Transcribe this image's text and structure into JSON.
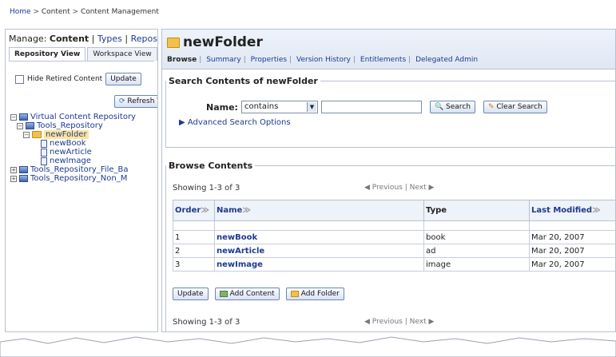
{
  "breadcrumb": [
    "Home",
    "Content",
    "Content Management"
  ],
  "left": {
    "manage_prefix": "Manage:",
    "manage_items": [
      "Content",
      "Types",
      "Repos"
    ],
    "tabs": [
      "Repository View",
      "Workspace View"
    ],
    "hide_retired_label": "Hide Retired Content",
    "update_label": "Update",
    "refresh_label": "Refresh Tree",
    "tree": [
      {
        "label": "Virtual Content Repository",
        "level": 0,
        "toggle": "−"
      },
      {
        "label": "Tools_Repository",
        "level": 1,
        "toggle": "−"
      },
      {
        "label": "newFolder",
        "level": 2,
        "toggle": "−",
        "selected": true
      },
      {
        "label": "newBook",
        "level": 3
      },
      {
        "label": "newArticle",
        "level": 3
      },
      {
        "label": "newImage",
        "level": 3
      },
      {
        "label": "Tools_Repository_File_Ba",
        "level": 0,
        "toggle": "+"
      },
      {
        "label": "Tools_Repository_Non_M",
        "level": 0,
        "toggle": "+"
      }
    ]
  },
  "main": {
    "title": "newFolder",
    "tabs": [
      "Browse",
      "Summary",
      "Properties",
      "Version History",
      "Entitlements",
      "Delegated Admin"
    ],
    "search": {
      "legend": "Search Contents of newFolder",
      "name_label": "Name:",
      "select_value": "contains",
      "search_button": "Search",
      "clear_button": "Clear Search",
      "advanced_link": "Advanced Search Options"
    },
    "browse": {
      "legend": "Browse Contents",
      "showing": "Showing 1-3 of 3",
      "pager_prev": "Previous",
      "pager_next": "Next",
      "columns": [
        "Order",
        "Name",
        "Type",
        "Last Modified"
      ],
      "rows": [
        {
          "order": "1",
          "name": "newBook",
          "type": "book",
          "modified": "Mar 20, 2007"
        },
        {
          "order": "2",
          "name": "newArticle",
          "type": "ad",
          "modified": "Mar 20, 2007"
        },
        {
          "order": "3",
          "name": "newImage",
          "type": "image",
          "modified": "Mar 20, 2007"
        }
      ],
      "update_button": "Update",
      "add_content_button": "Add Content",
      "add_folder_button": "Add Folder"
    }
  }
}
